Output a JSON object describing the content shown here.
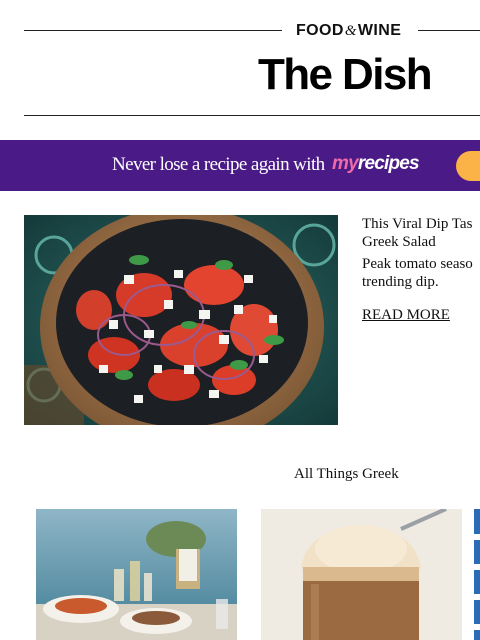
{
  "header": {
    "brand_left": "FOOD",
    "brand_amp": "&",
    "brand_right": "WINE",
    "newsletter_title": "The Dish"
  },
  "banner": {
    "text": "Never lose a recipe again with",
    "logo_my": "my",
    "logo_recipes": "recipes",
    "colors": {
      "background": "#4a1a86",
      "logo_my": "#f06aa8",
      "button": "#fbb347"
    }
  },
  "feature": {
    "title_line1": "This Viral Dip Tas",
    "title_line2": "Greek Salad",
    "desc_line1": "Peak tomato seaso",
    "desc_line2": "trending dip.",
    "read_more": "READ MORE",
    "image_icon": "greek-salad-bowl-photo"
  },
  "section": {
    "title": "All Things Greek",
    "cards": [
      {
        "image_icon": "seaside-table-food-photo"
      },
      {
        "image_icon": "iced-frappe-glass-photo"
      },
      {
        "image_icon": "blue-stripes-photo"
      }
    ]
  }
}
